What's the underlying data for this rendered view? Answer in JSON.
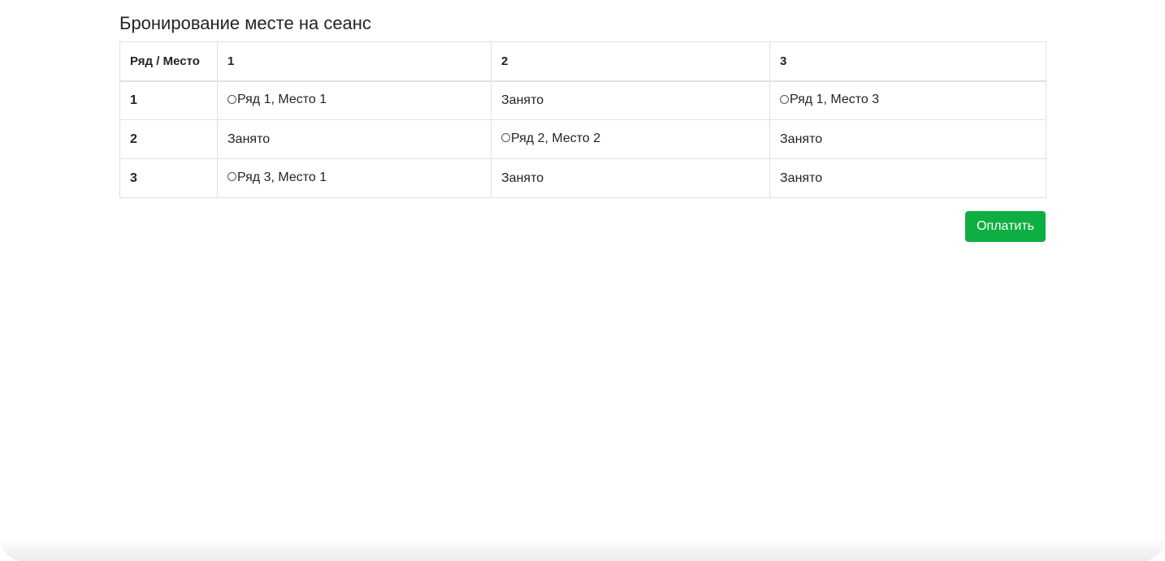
{
  "page": {
    "title": "Бронирование месте на сеанс"
  },
  "table": {
    "corner_header": "Ряд / Место",
    "column_headers": [
      "1",
      "2",
      "3"
    ],
    "rows": [
      {
        "label": "1",
        "cells": [
          {
            "type": "available",
            "text": "Ряд 1, Место 1"
          },
          {
            "type": "taken",
            "text": "Занято"
          },
          {
            "type": "available",
            "text": "Ряд 1, Место 3"
          }
        ]
      },
      {
        "label": "2",
        "cells": [
          {
            "type": "taken",
            "text": "Занято"
          },
          {
            "type": "available",
            "text": "Ряд 2, Место 2"
          },
          {
            "type": "taken",
            "text": "Занято"
          }
        ]
      },
      {
        "label": "3",
        "cells": [
          {
            "type": "available",
            "text": "Ряд 3, Место 1"
          },
          {
            "type": "taken",
            "text": "Занято"
          },
          {
            "type": "taken",
            "text": "Занято"
          }
        ]
      }
    ]
  },
  "actions": {
    "pay_label": "Оплатить"
  },
  "colors": {
    "pay_button": "#0eaf42",
    "border": "#dee2e6",
    "text": "#212529"
  }
}
